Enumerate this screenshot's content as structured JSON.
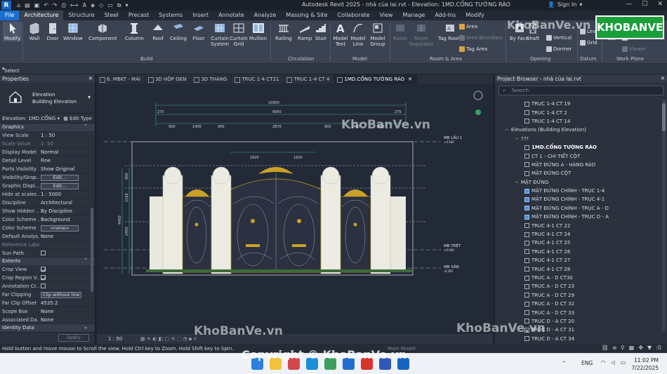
{
  "window": {
    "title": "Autodesk Revit 2025 - nhà của lai.rvt - Elevation: 1MD.CỔNG TƯỜNG RÀO",
    "signin": "Sign In"
  },
  "ribbon_tabs": [
    "File",
    "Architecture",
    "Structure",
    "Steel",
    "Precast",
    "Systems",
    "Insert",
    "Annotate",
    "Analyze",
    "Massing & Site",
    "Collaborate",
    "View",
    "Manage",
    "Add-Ins",
    "Modify"
  ],
  "ribbon": {
    "modify": "Modify",
    "wall": "Wall",
    "door": "Door",
    "window": "Window",
    "component": "Component",
    "column": "Column",
    "roof": "Roof",
    "ceiling": "Ceiling",
    "floor": "Floor",
    "curtain_system": "Curtain System",
    "curtain_grid": "Curtain Grid",
    "mullion": "Mullion",
    "railing": "Railing",
    "ramp": "Ramp",
    "stair": "Stair",
    "model_text": "Model Text",
    "model_line": "Model Line",
    "model_group": "Model Group",
    "room": "Room",
    "room_separator": "Room Separator",
    "tag_room": "Tag Room",
    "area": "Area",
    "area_boundary": "Area Boundary",
    "tag_area": "Tag Area",
    "by_face": "By Face",
    "shaft": "Shaft",
    "vertical": "Vertical",
    "dormer": "Dormer",
    "level": "Level",
    "grid": "Grid",
    "set": "Set",
    "ref_plane": "Ref. Plane",
    "viewer": "Viewer",
    "groups": [
      "Build",
      "Circulation",
      "Model",
      "Room & Area",
      "Opening",
      "Datum",
      "Work Plane"
    ]
  },
  "select_label": "Select",
  "properties": {
    "header": "Properties",
    "type_line1": "Elevation",
    "type_line2": "Building Elevation",
    "selector": "Elevation: 1MD.CỔNG",
    "edit_type": "Edit Type",
    "graphics_section": "Graphics",
    "rows": [
      {
        "k": "View Scale",
        "v": "1 : 50"
      },
      {
        "k": "Scale Value",
        "v": "1:  50"
      },
      {
        "k": "Display Model",
        "v": "Normal"
      },
      {
        "k": "Detail Level",
        "v": "Fine"
      },
      {
        "k": "Parts Visibility",
        "v": "Show Original"
      },
      {
        "k": "Visibility/Grap...",
        "v": "Edit..."
      },
      {
        "k": "Graphic Displ...",
        "v": "Edit..."
      },
      {
        "k": "Hide at scales ...",
        "v": "1 : 5000"
      },
      {
        "k": "Discipline",
        "v": "Architectural"
      },
      {
        "k": "Show Hidden ...",
        "v": "By Discipline"
      },
      {
        "k": "Color Scheme ...",
        "v": "Background"
      },
      {
        "k": "Color Scheme",
        "v": "<none>"
      },
      {
        "k": "Default Analys...",
        "v": "None"
      },
      {
        "k": "Reference Label",
        "v": ""
      },
      {
        "k": "Sun Path",
        "v": ""
      }
    ],
    "extents_section": "Extents",
    "extents": [
      {
        "k": "Crop View",
        "v": ""
      },
      {
        "k": "Crop Region V...",
        "v": ""
      },
      {
        "k": "Annotation Cr...",
        "v": ""
      },
      {
        "k": "Far Clipping",
        "v": "Clip without line"
      },
      {
        "k": "Far Clip Offset",
        "v": "4535.2"
      },
      {
        "k": "Scope Box",
        "v": "None"
      },
      {
        "k": "Associated Da...",
        "v": "None"
      }
    ],
    "identity_section": "Identity Data",
    "apply": "Apply"
  },
  "view_tabs": [
    "6. MBKT - MÁI",
    "3D HỘP GEN",
    "3D THANG",
    "TRUC 1-4 CT21",
    "TRUC 1-4 CT 4",
    "1MD.CỔNG TƯỜNG RÀO"
  ],
  "drawing": {
    "dims_top": [
      "10950",
      "275",
      "9950",
      "275",
      "900",
      "1400",
      "900",
      "2870",
      "900",
      "1400",
      "900",
      "1620",
      "1620"
    ],
    "dims_left": [
      "900",
      "1160",
      "2450",
      "4450"
    ],
    "levels": [
      {
        "name": "MB LẦU 1",
        "elev": "+4.500"
      },
      {
        "name": "MB TRỆT",
        "elev": "+0.000"
      },
      {
        "name": "MB SÂN",
        "elev": "-0.350"
      }
    ]
  },
  "view_control_scale": "1 : 50",
  "project_browser": {
    "header": "Project Browser - nhà của lai.rvt",
    "search_placeholder": "Search",
    "items": [
      {
        "label": "TRUC 1-4 CT 19",
        "indent": 3,
        "kind": "box"
      },
      {
        "label": "TRUC 1-4 CT 2",
        "indent": 3,
        "kind": "box"
      },
      {
        "label": "TRUC 1-4 CT 14",
        "indent": 3,
        "kind": "box"
      },
      {
        "label": "Elevations (Building Elevation)",
        "indent": 1,
        "kind": "group"
      },
      {
        "label": "???",
        "indent": 2,
        "kind": "group"
      },
      {
        "label": "1MD.CỔNG TƯỜNG RÀO",
        "indent": 3,
        "kind": "sel"
      },
      {
        "label": "CT 1 - CHI TIẾT CỘT",
        "indent": 3,
        "kind": "box"
      },
      {
        "label": "MẶT ĐỨNG A - HÀNG RÀO",
        "indent": 3,
        "kind": "box"
      },
      {
        "label": "MẶT ĐỨNG CỘT",
        "indent": 3,
        "kind": "box"
      },
      {
        "label": "MẶT ĐỨNG",
        "indent": 2,
        "kind": "group"
      },
      {
        "label": "MẶT ĐỨNG CHÍNH - TRỤC 1-4",
        "indent": 3,
        "kind": "blue"
      },
      {
        "label": "MẶT ĐỨNG CHÍNH - TRỤC 4-1",
        "indent": 3,
        "kind": "blue"
      },
      {
        "label": "MẶT ĐỨNG CHÍNH - TRỤC A - D",
        "indent": 3,
        "kind": "blue"
      },
      {
        "label": "MẶT ĐỨNG CHÍNH - TRỤC D - A",
        "indent": 3,
        "kind": "blue"
      },
      {
        "label": "TRUC 4-1 CT 22",
        "indent": 3,
        "kind": "box"
      },
      {
        "label": "TRUC 4-1 CT 24",
        "indent": 3,
        "kind": "box"
      },
      {
        "label": "TRUC 4-1 CT 25",
        "indent": 3,
        "kind": "box"
      },
      {
        "label": "TRUC 4-1 CT 26",
        "indent": 3,
        "kind": "box"
      },
      {
        "label": "TRUC 4-1 CT 27",
        "indent": 3,
        "kind": "box"
      },
      {
        "label": "TRUC 4-1 CT 28",
        "indent": 3,
        "kind": "box"
      },
      {
        "label": "TRUC A - D CT30",
        "indent": 3,
        "kind": "box"
      },
      {
        "label": "TRUC A - D CT 23",
        "indent": 3,
        "kind": "box"
      },
      {
        "label": "TRUC A - D CT 29",
        "indent": 3,
        "kind": "box"
      },
      {
        "label": "TRUC A - D CT 32",
        "indent": 3,
        "kind": "box"
      },
      {
        "label": "TRUC A - D CT 33",
        "indent": 3,
        "kind": "box"
      },
      {
        "label": "TRUC D - A CT 20",
        "indent": 3,
        "kind": "box"
      },
      {
        "label": "TRUC D - A CT 31",
        "indent": 3,
        "kind": "box"
      },
      {
        "label": "TRUC D - A CT 34",
        "indent": 3,
        "kind": "box"
      }
    ]
  },
  "status": {
    "message": "Hold button and move mouse to Scroll the view. Hold Ctrl key to Zoom. Hold Shift key to Spin.",
    "main_model": "Main Model",
    "filter_count": ":0"
  },
  "taskbar": {
    "lang": "ENG",
    "time": "11:02 PM",
    "date": "7/22/2025"
  },
  "watermarks": {
    "text": "KhoBanVe.vn",
    "copyright": "Copyright © KhoBanVe.vn",
    "logo": "KHOBANVE"
  },
  "colors": {
    "accent": "#1a6fd1",
    "canvas": "#232a37",
    "ribbon": "#3b4352",
    "gold": "#c9a227"
  }
}
